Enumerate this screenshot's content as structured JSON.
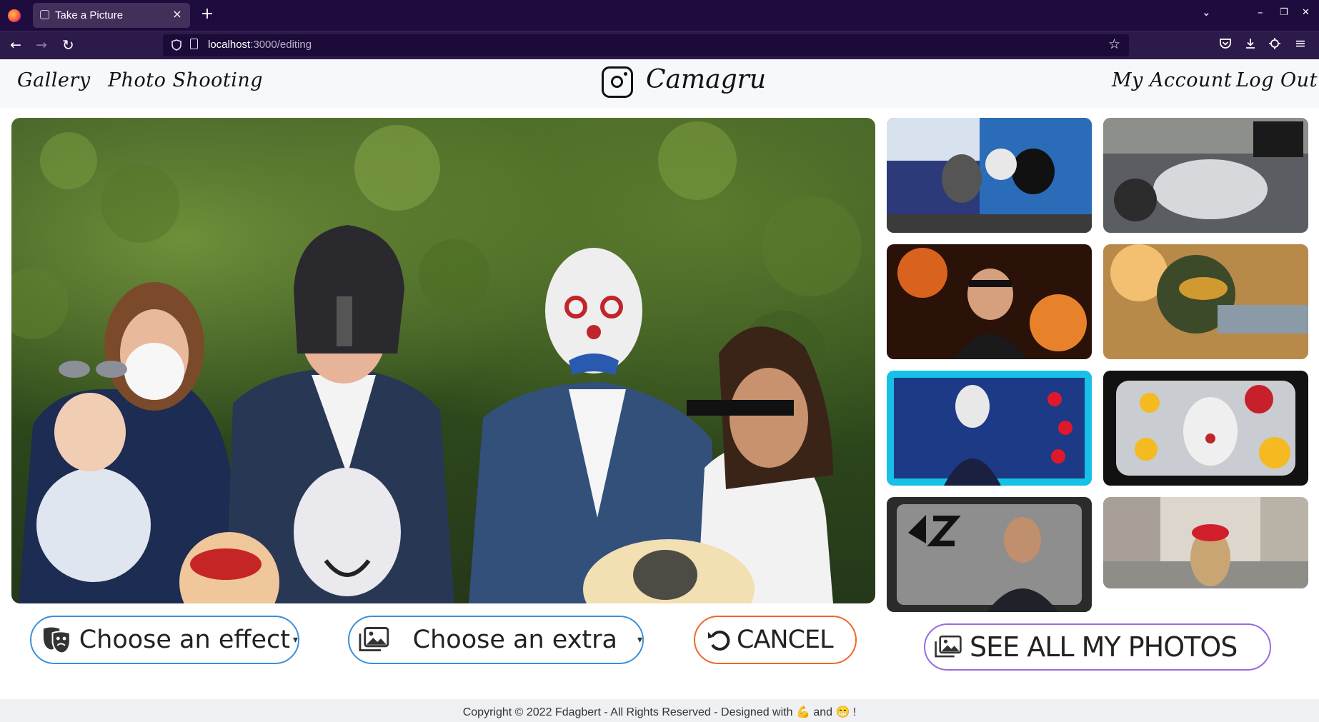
{
  "browser": {
    "tab_title": "Take a Picture",
    "tab_close": "×",
    "new_tab": "+",
    "url_host": "localhost",
    "url_path": ":3000/editing",
    "back": "←",
    "forward": "→",
    "reload": "↻",
    "bookmark_star": "☆",
    "list_tabs": "⌄",
    "minimize": "–",
    "restore": "❐",
    "close": "✕",
    "menu": "≡"
  },
  "site": {
    "nav_left": [
      "Gallery",
      "Photo Shooting"
    ],
    "brand": "Camagru",
    "nav_right": [
      "My Account",
      "Log Out"
    ]
  },
  "controls": {
    "effect_label": "Choose an effect",
    "extra_label": "Choose an extra",
    "cancel_label": "CANCEL",
    "see_all_label": "SEE ALL MY PHOTOS"
  },
  "footer": {
    "text": "Copyright © 2022 Fdagbert - All Rights Reserved - Designed with 💪 and 😁 !"
  },
  "colors": {
    "chrome_dark": "#1f0c3f",
    "button_blue": "#3a8fd9",
    "button_orange": "#f0652b",
    "button_purple": "#9b6ae0"
  }
}
